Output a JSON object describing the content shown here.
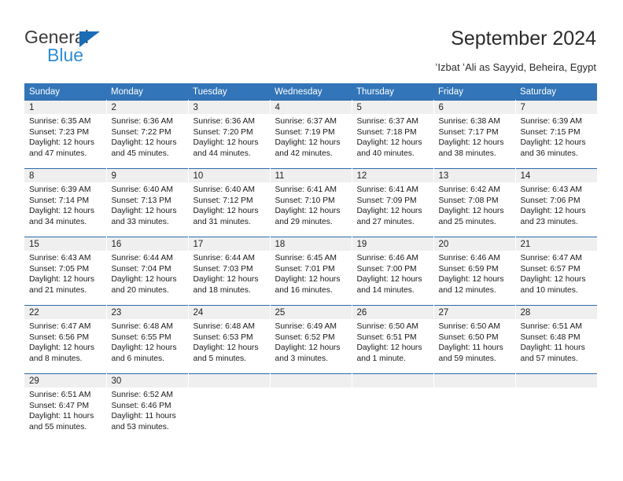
{
  "brand": {
    "name_top": "General",
    "name_bottom": "Blue",
    "accent_color": "#2f8ed6",
    "triangle_color": "#1b6cb5"
  },
  "header": {
    "title": "September 2024",
    "subtitle": "ʻIzbat ʻAli as Sayyid, Beheira, Egypt"
  },
  "calendar": {
    "header_bg": "#3275b8",
    "header_text_color": "#ffffff",
    "row_divider_color": "#2d6aa8",
    "daynum_band_color": "#efefef",
    "weekdays": [
      "Sunday",
      "Monday",
      "Tuesday",
      "Wednesday",
      "Thursday",
      "Friday",
      "Saturday"
    ],
    "weeks": [
      [
        {
          "day": "1",
          "sunrise": "Sunrise: 6:35 AM",
          "sunset": "Sunset: 7:23 PM",
          "daylight_1": "Daylight: 12 hours",
          "daylight_2": "and 47 minutes."
        },
        {
          "day": "2",
          "sunrise": "Sunrise: 6:36 AM",
          "sunset": "Sunset: 7:22 PM",
          "daylight_1": "Daylight: 12 hours",
          "daylight_2": "and 45 minutes."
        },
        {
          "day": "3",
          "sunrise": "Sunrise: 6:36 AM",
          "sunset": "Sunset: 7:20 PM",
          "daylight_1": "Daylight: 12 hours",
          "daylight_2": "and 44 minutes."
        },
        {
          "day": "4",
          "sunrise": "Sunrise: 6:37 AM",
          "sunset": "Sunset: 7:19 PM",
          "daylight_1": "Daylight: 12 hours",
          "daylight_2": "and 42 minutes."
        },
        {
          "day": "5",
          "sunrise": "Sunrise: 6:37 AM",
          "sunset": "Sunset: 7:18 PM",
          "daylight_1": "Daylight: 12 hours",
          "daylight_2": "and 40 minutes."
        },
        {
          "day": "6",
          "sunrise": "Sunrise: 6:38 AM",
          "sunset": "Sunset: 7:17 PM",
          "daylight_1": "Daylight: 12 hours",
          "daylight_2": "and 38 minutes."
        },
        {
          "day": "7",
          "sunrise": "Sunrise: 6:39 AM",
          "sunset": "Sunset: 7:15 PM",
          "daylight_1": "Daylight: 12 hours",
          "daylight_2": "and 36 minutes."
        }
      ],
      [
        {
          "day": "8",
          "sunrise": "Sunrise: 6:39 AM",
          "sunset": "Sunset: 7:14 PM",
          "daylight_1": "Daylight: 12 hours",
          "daylight_2": "and 34 minutes."
        },
        {
          "day": "9",
          "sunrise": "Sunrise: 6:40 AM",
          "sunset": "Sunset: 7:13 PM",
          "daylight_1": "Daylight: 12 hours",
          "daylight_2": "and 33 minutes."
        },
        {
          "day": "10",
          "sunrise": "Sunrise: 6:40 AM",
          "sunset": "Sunset: 7:12 PM",
          "daylight_1": "Daylight: 12 hours",
          "daylight_2": "and 31 minutes."
        },
        {
          "day": "11",
          "sunrise": "Sunrise: 6:41 AM",
          "sunset": "Sunset: 7:10 PM",
          "daylight_1": "Daylight: 12 hours",
          "daylight_2": "and 29 minutes."
        },
        {
          "day": "12",
          "sunrise": "Sunrise: 6:41 AM",
          "sunset": "Sunset: 7:09 PM",
          "daylight_1": "Daylight: 12 hours",
          "daylight_2": "and 27 minutes."
        },
        {
          "day": "13",
          "sunrise": "Sunrise: 6:42 AM",
          "sunset": "Sunset: 7:08 PM",
          "daylight_1": "Daylight: 12 hours",
          "daylight_2": "and 25 minutes."
        },
        {
          "day": "14",
          "sunrise": "Sunrise: 6:43 AM",
          "sunset": "Sunset: 7:06 PM",
          "daylight_1": "Daylight: 12 hours",
          "daylight_2": "and 23 minutes."
        }
      ],
      [
        {
          "day": "15",
          "sunrise": "Sunrise: 6:43 AM",
          "sunset": "Sunset: 7:05 PM",
          "daylight_1": "Daylight: 12 hours",
          "daylight_2": "and 21 minutes."
        },
        {
          "day": "16",
          "sunrise": "Sunrise: 6:44 AM",
          "sunset": "Sunset: 7:04 PM",
          "daylight_1": "Daylight: 12 hours",
          "daylight_2": "and 20 minutes."
        },
        {
          "day": "17",
          "sunrise": "Sunrise: 6:44 AM",
          "sunset": "Sunset: 7:03 PM",
          "daylight_1": "Daylight: 12 hours",
          "daylight_2": "and 18 minutes."
        },
        {
          "day": "18",
          "sunrise": "Sunrise: 6:45 AM",
          "sunset": "Sunset: 7:01 PM",
          "daylight_1": "Daylight: 12 hours",
          "daylight_2": "and 16 minutes."
        },
        {
          "day": "19",
          "sunrise": "Sunrise: 6:46 AM",
          "sunset": "Sunset: 7:00 PM",
          "daylight_1": "Daylight: 12 hours",
          "daylight_2": "and 14 minutes."
        },
        {
          "day": "20",
          "sunrise": "Sunrise: 6:46 AM",
          "sunset": "Sunset: 6:59 PM",
          "daylight_1": "Daylight: 12 hours",
          "daylight_2": "and 12 minutes."
        },
        {
          "day": "21",
          "sunrise": "Sunrise: 6:47 AM",
          "sunset": "Sunset: 6:57 PM",
          "daylight_1": "Daylight: 12 hours",
          "daylight_2": "and 10 minutes."
        }
      ],
      [
        {
          "day": "22",
          "sunrise": "Sunrise: 6:47 AM",
          "sunset": "Sunset: 6:56 PM",
          "daylight_1": "Daylight: 12 hours",
          "daylight_2": "and 8 minutes."
        },
        {
          "day": "23",
          "sunrise": "Sunrise: 6:48 AM",
          "sunset": "Sunset: 6:55 PM",
          "daylight_1": "Daylight: 12 hours",
          "daylight_2": "and 6 minutes."
        },
        {
          "day": "24",
          "sunrise": "Sunrise: 6:48 AM",
          "sunset": "Sunset: 6:53 PM",
          "daylight_1": "Daylight: 12 hours",
          "daylight_2": "and 5 minutes."
        },
        {
          "day": "25",
          "sunrise": "Sunrise: 6:49 AM",
          "sunset": "Sunset: 6:52 PM",
          "daylight_1": "Daylight: 12 hours",
          "daylight_2": "and 3 minutes."
        },
        {
          "day": "26",
          "sunrise": "Sunrise: 6:50 AM",
          "sunset": "Sunset: 6:51 PM",
          "daylight_1": "Daylight: 12 hours",
          "daylight_2": "and 1 minute."
        },
        {
          "day": "27",
          "sunrise": "Sunrise: 6:50 AM",
          "sunset": "Sunset: 6:50 PM",
          "daylight_1": "Daylight: 11 hours",
          "daylight_2": "and 59 minutes."
        },
        {
          "day": "28",
          "sunrise": "Sunrise: 6:51 AM",
          "sunset": "Sunset: 6:48 PM",
          "daylight_1": "Daylight: 11 hours",
          "daylight_2": "and 57 minutes."
        }
      ],
      [
        {
          "day": "29",
          "sunrise": "Sunrise: 6:51 AM",
          "sunset": "Sunset: 6:47 PM",
          "daylight_1": "Daylight: 11 hours",
          "daylight_2": "and 55 minutes."
        },
        {
          "day": "30",
          "sunrise": "Sunrise: 6:52 AM",
          "sunset": "Sunset: 6:46 PM",
          "daylight_1": "Daylight: 11 hours",
          "daylight_2": "and 53 minutes."
        },
        {
          "day": "",
          "sunrise": "",
          "sunset": "",
          "daylight_1": "",
          "daylight_2": ""
        },
        {
          "day": "",
          "sunrise": "",
          "sunset": "",
          "daylight_1": "",
          "daylight_2": ""
        },
        {
          "day": "",
          "sunrise": "",
          "sunset": "",
          "daylight_1": "",
          "daylight_2": ""
        },
        {
          "day": "",
          "sunrise": "",
          "sunset": "",
          "daylight_1": "",
          "daylight_2": ""
        },
        {
          "day": "",
          "sunrise": "",
          "sunset": "",
          "daylight_1": "",
          "daylight_2": ""
        }
      ]
    ]
  }
}
